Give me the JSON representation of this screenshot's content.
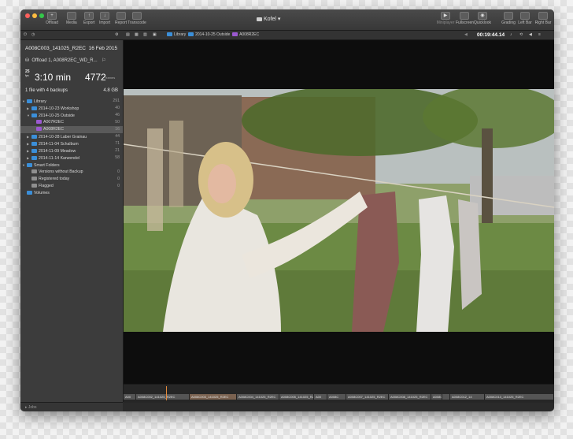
{
  "window": {
    "title": "Kofel"
  },
  "toolbar": {
    "left": [
      {
        "label": "Offload",
        "icon": "offload-icon"
      },
      {
        "label": "Media",
        "icon": "media-icon"
      },
      {
        "label": "Export",
        "icon": "export-icon"
      },
      {
        "label": "Import",
        "icon": "import-icon"
      },
      {
        "label": "Report",
        "icon": "report-icon"
      },
      {
        "label": "Transcode",
        "icon": "transcode-icon"
      }
    ],
    "right": [
      {
        "label": "Miniplayer",
        "icon": "play-icon"
      },
      {
        "label": "Fullscreen",
        "icon": "fullscreen-icon"
      },
      {
        "label": "Quicklook",
        "icon": "quicklook-icon"
      },
      {
        "label": "Grading",
        "icon": "grading-icon"
      },
      {
        "label": "Left Bar",
        "icon": "left-bar-icon"
      },
      {
        "label": "Right Bar",
        "icon": "right-bar-icon"
      }
    ]
  },
  "breadcrumb": [
    "Library",
    "2014-10-25 Outside",
    "A008R2EC"
  ],
  "timecode": "00:19:44.14",
  "clip": {
    "name": "A008C003_141025_R2EC",
    "date": "16 Feb 2015",
    "offload": "Offload 1, A008R2EC_WD_R...",
    "fps": "25",
    "fps_unit": "fps",
    "duration": "3:10 min",
    "frames": "4772",
    "frames_label": "frames",
    "files": "1 file with 4 backups",
    "size": "4.8 GB"
  },
  "tree": [
    {
      "label": "Library",
      "count": "291",
      "level": 0,
      "kind": "folder",
      "expanded": true
    },
    {
      "label": "2014-10-23 Workshop",
      "count": "40",
      "level": 1,
      "kind": "folder",
      "expanded": false
    },
    {
      "label": "2014-10-25 Outside",
      "count": "46",
      "level": 1,
      "kind": "folder",
      "expanded": true
    },
    {
      "label": "A007R2EC",
      "count": "50",
      "level": 2,
      "kind": "clip"
    },
    {
      "label": "A008R2EC",
      "count": "16",
      "level": 2,
      "kind": "clip",
      "selected": true
    },
    {
      "label": "2014-10-28 Laber Grainau",
      "count": "44",
      "level": 1,
      "kind": "folder",
      "expanded": false
    },
    {
      "label": "2014-11-04 Schalbum",
      "count": "71",
      "level": 1,
      "kind": "folder",
      "expanded": false
    },
    {
      "label": "2014-11-09 Meadow",
      "count": "21",
      "level": 1,
      "kind": "folder",
      "expanded": false
    },
    {
      "label": "2014-11-14 Karwendel",
      "count": "58",
      "level": 1,
      "kind": "folder",
      "expanded": false
    },
    {
      "label": "Smart Folders",
      "count": "",
      "level": 0,
      "kind": "folder",
      "expanded": true
    },
    {
      "label": "Versions without Backup",
      "count": "0",
      "level": 1,
      "kind": "smart"
    },
    {
      "label": "Registered today",
      "count": "0",
      "level": 1,
      "kind": "smart"
    },
    {
      "label": "Flagged",
      "count": "0",
      "level": 1,
      "kind": "smart"
    },
    {
      "label": "Volumes",
      "count": "",
      "level": 0,
      "kind": "folder",
      "expanded": false
    }
  ],
  "jobs_label": "Jobs",
  "timeline": {
    "segments": [
      "A00",
      "A008C002_141025_R2EC",
      "A008C003_141025_R2EC",
      "A008C004_141025_R2EC",
      "A008C005_141025_R2EC",
      "A00",
      "A008C",
      "A008C007_141025_R2EC",
      "A008C008_141025_R2EC",
      "A008C",
      "",
      "A008C012_14",
      "A008C013_141025_R2EC"
    ]
  },
  "colors": {
    "accent": "#3b8fd9",
    "clip": "#9b59d0",
    "playhead": "#e58a3c"
  }
}
